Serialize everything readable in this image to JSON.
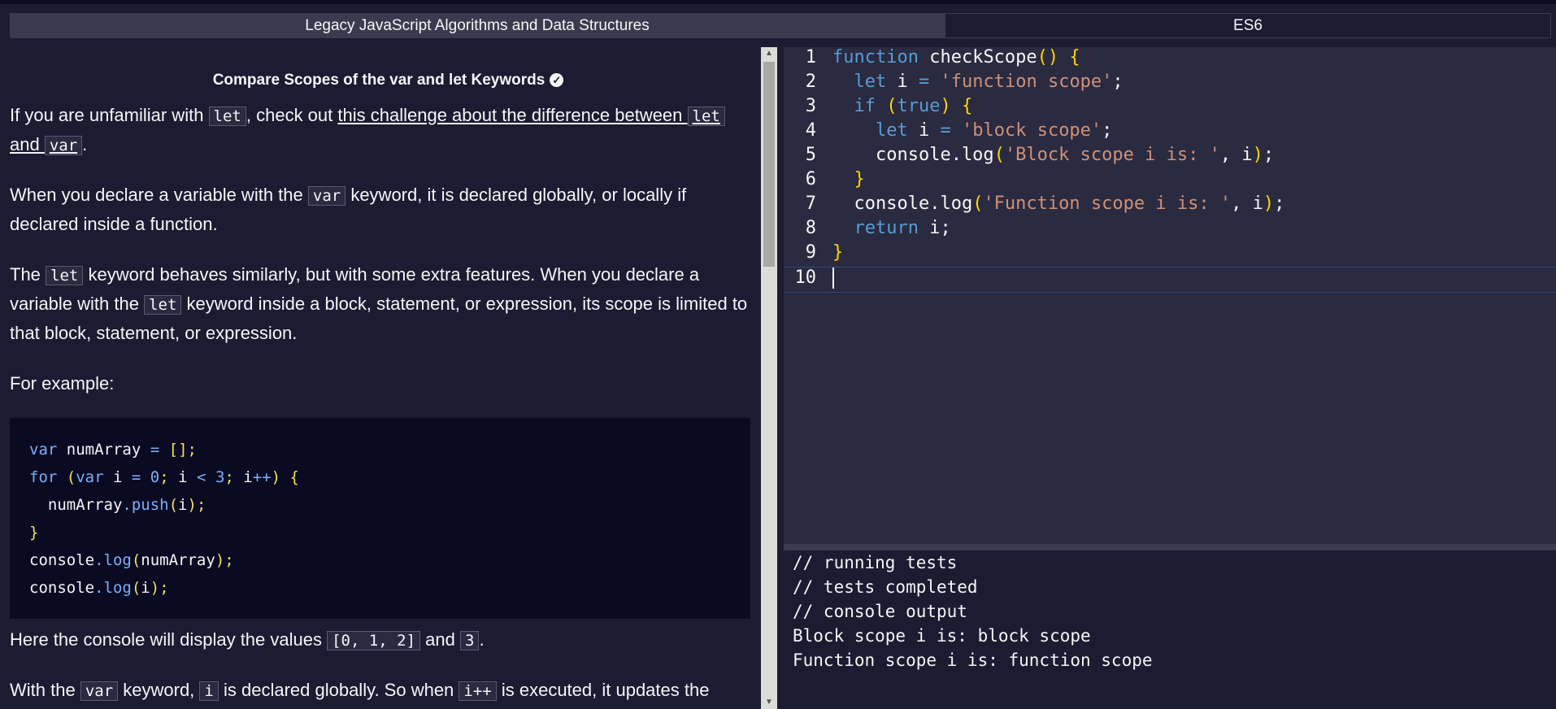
{
  "breadcrumb": {
    "section": "Legacy JavaScript Algorithms and Data Structures",
    "subsection": "ES6"
  },
  "challenge": {
    "title": "Compare Scopes of the var and let Keywords",
    "p1": {
      "a": "If you are unfamiliar with ",
      "code1": "let",
      "b": ", check out ",
      "link_a": "this challenge about the difference between ",
      "code2": "let",
      "link_b": "and ",
      "code3": "var",
      "c": "."
    },
    "p2": {
      "a": "When you declare a variable with the ",
      "code1": "var",
      "b": " keyword, it is declared globally, or locally if declared inside a function."
    },
    "p3": {
      "a": "The ",
      "code1": "let",
      "b": " keyword behaves similarly, but with some extra features. When you declare a variable with the ",
      "code2": "let",
      "c": " keyword inside a block, statement, or expression, its scope is limited to that block, statement, or expression."
    },
    "p4": "For example:",
    "p5": {
      "a": "Here the console will display the values ",
      "code1": "[0, 1, 2]",
      "b": " and ",
      "code2": "3",
      "c": "."
    },
    "p6": {
      "a": "With the ",
      "code1": "var",
      "b": " keyword, ",
      "code2": "i",
      "c": " is declared globally. So when ",
      "code3": "i++",
      "d": " is executed, it updates the"
    }
  },
  "editor": {
    "line_numbers": [
      "1",
      "2",
      "3",
      "4",
      "5",
      "6",
      "7",
      "8",
      "9",
      "10"
    ]
  },
  "console": {
    "lines": [
      "// running tests",
      "// tests completed",
      "// console output",
      "Block scope i is:  block scope",
      "Function scope i is:  function scope"
    ]
  },
  "colors": {
    "background": "#1b1b32",
    "editor_bg": "#2a2a40",
    "code_bg": "#0a0a23",
    "keyword": "#569cd6",
    "string": "#ce9178",
    "bracket": "#ffd700"
  },
  "icons": {
    "completed": "check-circle-icon"
  }
}
